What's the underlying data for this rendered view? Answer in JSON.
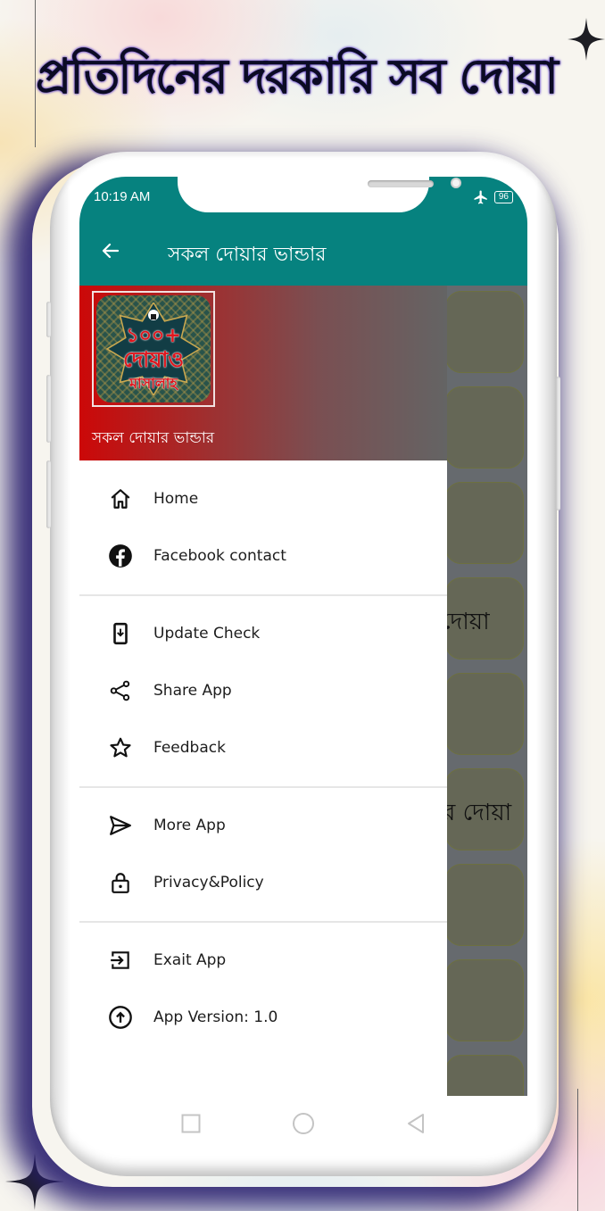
{
  "headline": "প্রতিদিনের দরকারি সব দোয়া",
  "status_bar": {
    "time": "10:19 AM",
    "airplane_icon": "airplane-icon",
    "battery_level": "96"
  },
  "app_bar": {
    "back_icon": "arrow-left-icon",
    "title": "সকল দোয়ার ভান্ডার"
  },
  "drawer": {
    "header": {
      "logo": {
        "line1": "১০০+",
        "line2": "দোয়াও",
        "line3": "মাসালাহ"
      },
      "subtitle": "সকল দোয়ার ভান্ডার"
    },
    "groups": [
      {
        "items": [
          {
            "label": "Home",
            "icon": "home-icon"
          },
          {
            "label": "Facebook contact",
            "icon": "facebook-icon"
          }
        ]
      },
      {
        "items": [
          {
            "label": "Update Check",
            "icon": "phone-download-icon"
          },
          {
            "label": "Share App",
            "icon": "share-icon"
          },
          {
            "label": "Feedback",
            "icon": "star-icon"
          }
        ]
      },
      {
        "items": [
          {
            "label": "More App",
            "icon": "send-icon"
          },
          {
            "label": "Privacy&Policy",
            "icon": "lock-icon"
          }
        ]
      },
      {
        "items": [
          {
            "label": "Exait App",
            "icon": "exit-icon"
          },
          {
            "label": "App Version: 1.0",
            "icon": "arrow-up-circle-icon"
          }
        ]
      }
    ]
  },
  "background_list": {
    "visible_text": [
      "দোয়া",
      "র দোয়া"
    ]
  },
  "nav_bar": {
    "recents_icon": "square-icon",
    "home_icon": "circle-icon",
    "back_icon": "triangle-back-icon"
  },
  "colors": {
    "app_bar": "#06827f",
    "drawer_header_start": "#cc0808",
    "drawer_header_end": "#646464",
    "scrim": "#666a6e",
    "headline_text": "#0b0b24"
  }
}
